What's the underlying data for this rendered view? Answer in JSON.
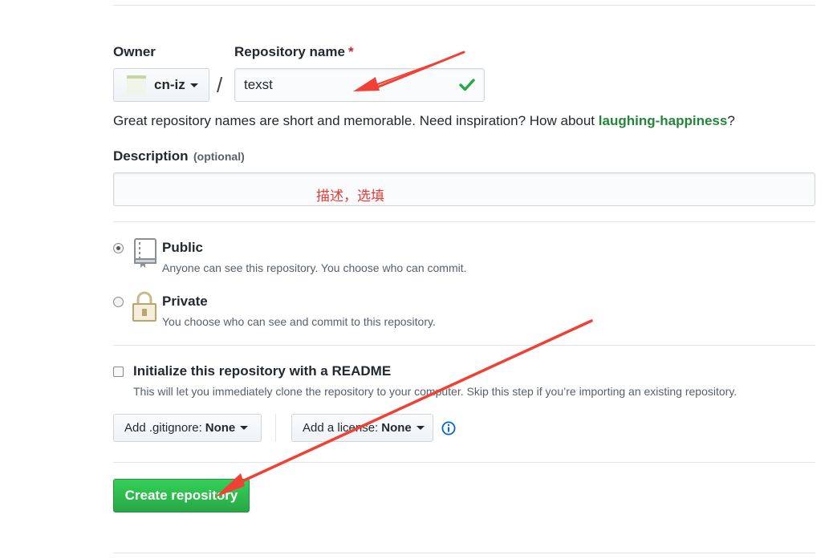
{
  "owner": {
    "label": "Owner",
    "value": "cn-iz"
  },
  "separator": "/",
  "repo": {
    "label": "Repository name",
    "required_mark": "*",
    "value": "texst"
  },
  "suggestion": {
    "text": "Great repository names are short and memorable. Need inspiration? How about ",
    "name": "laughing-happiness",
    "end": "?"
  },
  "description": {
    "label": "Description",
    "optional": "(optional)",
    "annotation": "描述，选填"
  },
  "visibility": {
    "public": {
      "label": "Public",
      "desc": "Anyone can see this repository. You choose who can commit."
    },
    "private": {
      "label": "Private",
      "desc": "You choose who can see and commit to this repository."
    }
  },
  "readme": {
    "label": "Initialize this repository with a README",
    "desc": "This will let you immediately clone the repository to your computer. Skip this step if you’re importing an existing repository."
  },
  "gitignore": {
    "prefix": "Add .gitignore:",
    "value": "None"
  },
  "license": {
    "prefix": "Add a license:",
    "value": "None"
  },
  "create_button": "Create repository",
  "colors": {
    "green": "#2cbe4e",
    "link_green": "#22863a",
    "annotation_red": "#e53935",
    "arrow_red": "#ef4136",
    "info_blue": "#0366d6"
  }
}
